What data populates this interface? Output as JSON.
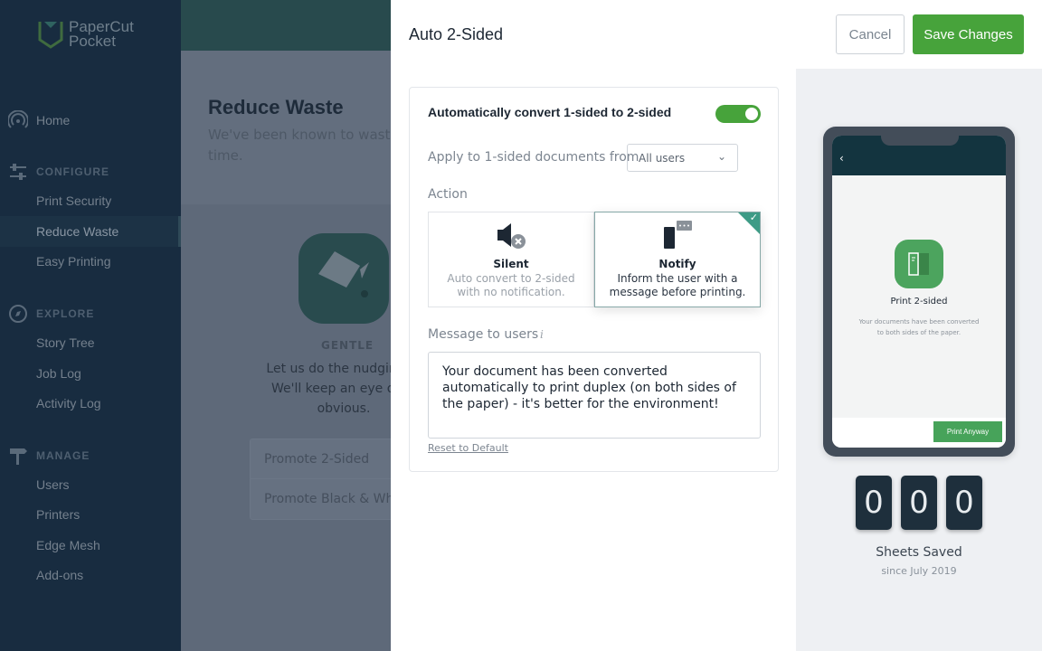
{
  "brand": {
    "line1": "PaperCut",
    "line2": "Pocket"
  },
  "sidebar": {
    "home": "Home",
    "configure": {
      "title": "CONFIGURE",
      "items": [
        "Print Security",
        "Reduce Waste",
        "Easy Printing"
      ]
    },
    "explore": {
      "title": "EXPLORE",
      "items": [
        "Story Tree",
        "Job Log",
        "Activity Log"
      ]
    },
    "manage": {
      "title": "MANAGE",
      "items": [
        "Users",
        "Printers",
        "Edge Mesh",
        "Add-ons"
      ]
    },
    "active": "Reduce Waste"
  },
  "background": {
    "title": "Reduce Waste",
    "subtitle_line1": "We've been known to waste a",
    "subtitle_line2": "time.",
    "level": "GENTLE",
    "desc": "Let us do the nudging fo We'll keep an eye out f obvious.",
    "options": [
      "Promote 2-Sided",
      "Promote Black & White"
    ]
  },
  "modal": {
    "title": "Auto 2-Sided",
    "cancel": "Cancel",
    "save": "Save Changes",
    "toggle_label": "Automatically convert 1-sided to 2-sided",
    "toggle_on": true,
    "apply_label": "Apply to 1-sided documents from",
    "apply_value": "All users",
    "action_label": "Action",
    "actions": [
      {
        "title": "Silent",
        "desc": "Auto convert to 2-sided with no notification.",
        "selected": false
      },
      {
        "title": "Notify",
        "desc": "Inform the user with a message before printing.",
        "selected": true
      }
    ],
    "message_label": "Message to users",
    "message": "Your document has been converted automatically to print duplex (on both sides of the paper) - it's better for the environment!",
    "reset": "Reset to Default"
  },
  "preview": {
    "phone_title": "Print 2-sided",
    "phone_desc": "Your documents have been converted to both sides of the paper.",
    "phone_button": "Print Anyway",
    "digits": [
      "0",
      "0",
      "0"
    ],
    "sheets_label": "Sheets Saved",
    "since": "since July 2019"
  },
  "colors": {
    "accent": "#47a33b",
    "sidebar": "#182c40",
    "teal": "#3e9b86"
  }
}
